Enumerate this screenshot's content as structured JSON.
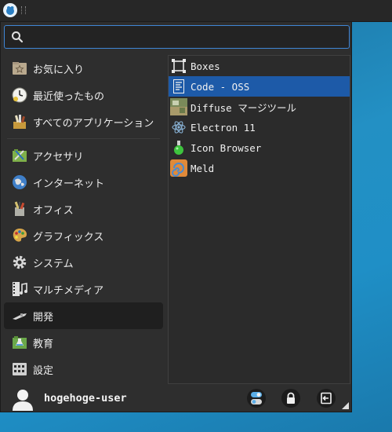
{
  "search": {
    "value": "",
    "placeholder": ""
  },
  "categories": [
    {
      "label": "お気に入り",
      "icon": "favorites-icon"
    },
    {
      "label": "最近使ったもの",
      "icon": "recent-clock-icon"
    },
    {
      "label": "すべてのアプリケーション",
      "icon": "all-applications-icon"
    },
    {
      "label": "アクセサリ",
      "icon": "accessories-icon"
    },
    {
      "label": "インターネット",
      "icon": "internet-globe-icon"
    },
    {
      "label": "オフィス",
      "icon": "office-icon"
    },
    {
      "label": "グラフィックス",
      "icon": "graphics-palette-icon"
    },
    {
      "label": "システム",
      "icon": "system-gear-icon"
    },
    {
      "label": "マルチメディア",
      "icon": "multimedia-icon"
    },
    {
      "label": "開発",
      "icon": "development-icon",
      "selected": true
    },
    {
      "label": "教育",
      "icon": "education-icon"
    },
    {
      "label": "設定",
      "icon": "settings-icon"
    }
  ],
  "apps": [
    {
      "label": "Boxes",
      "icon": "boxes-icon"
    },
    {
      "label": "Code - OSS",
      "icon": "code-oss-icon",
      "selected": true
    },
    {
      "label": "Diffuse マージツール",
      "icon": "diffuse-icon"
    },
    {
      "label": "Electron 11",
      "icon": "electron-icon"
    },
    {
      "label": "Icon Browser",
      "icon": "icon-browser-flask-icon"
    },
    {
      "label": "Meld",
      "icon": "meld-icon"
    }
  ],
  "user": {
    "name": "hogehoge-user"
  },
  "colors": {
    "accent": "#3f86d6",
    "selected_app": "#1d5aa8",
    "menu_bg": "#2e2e2e"
  }
}
